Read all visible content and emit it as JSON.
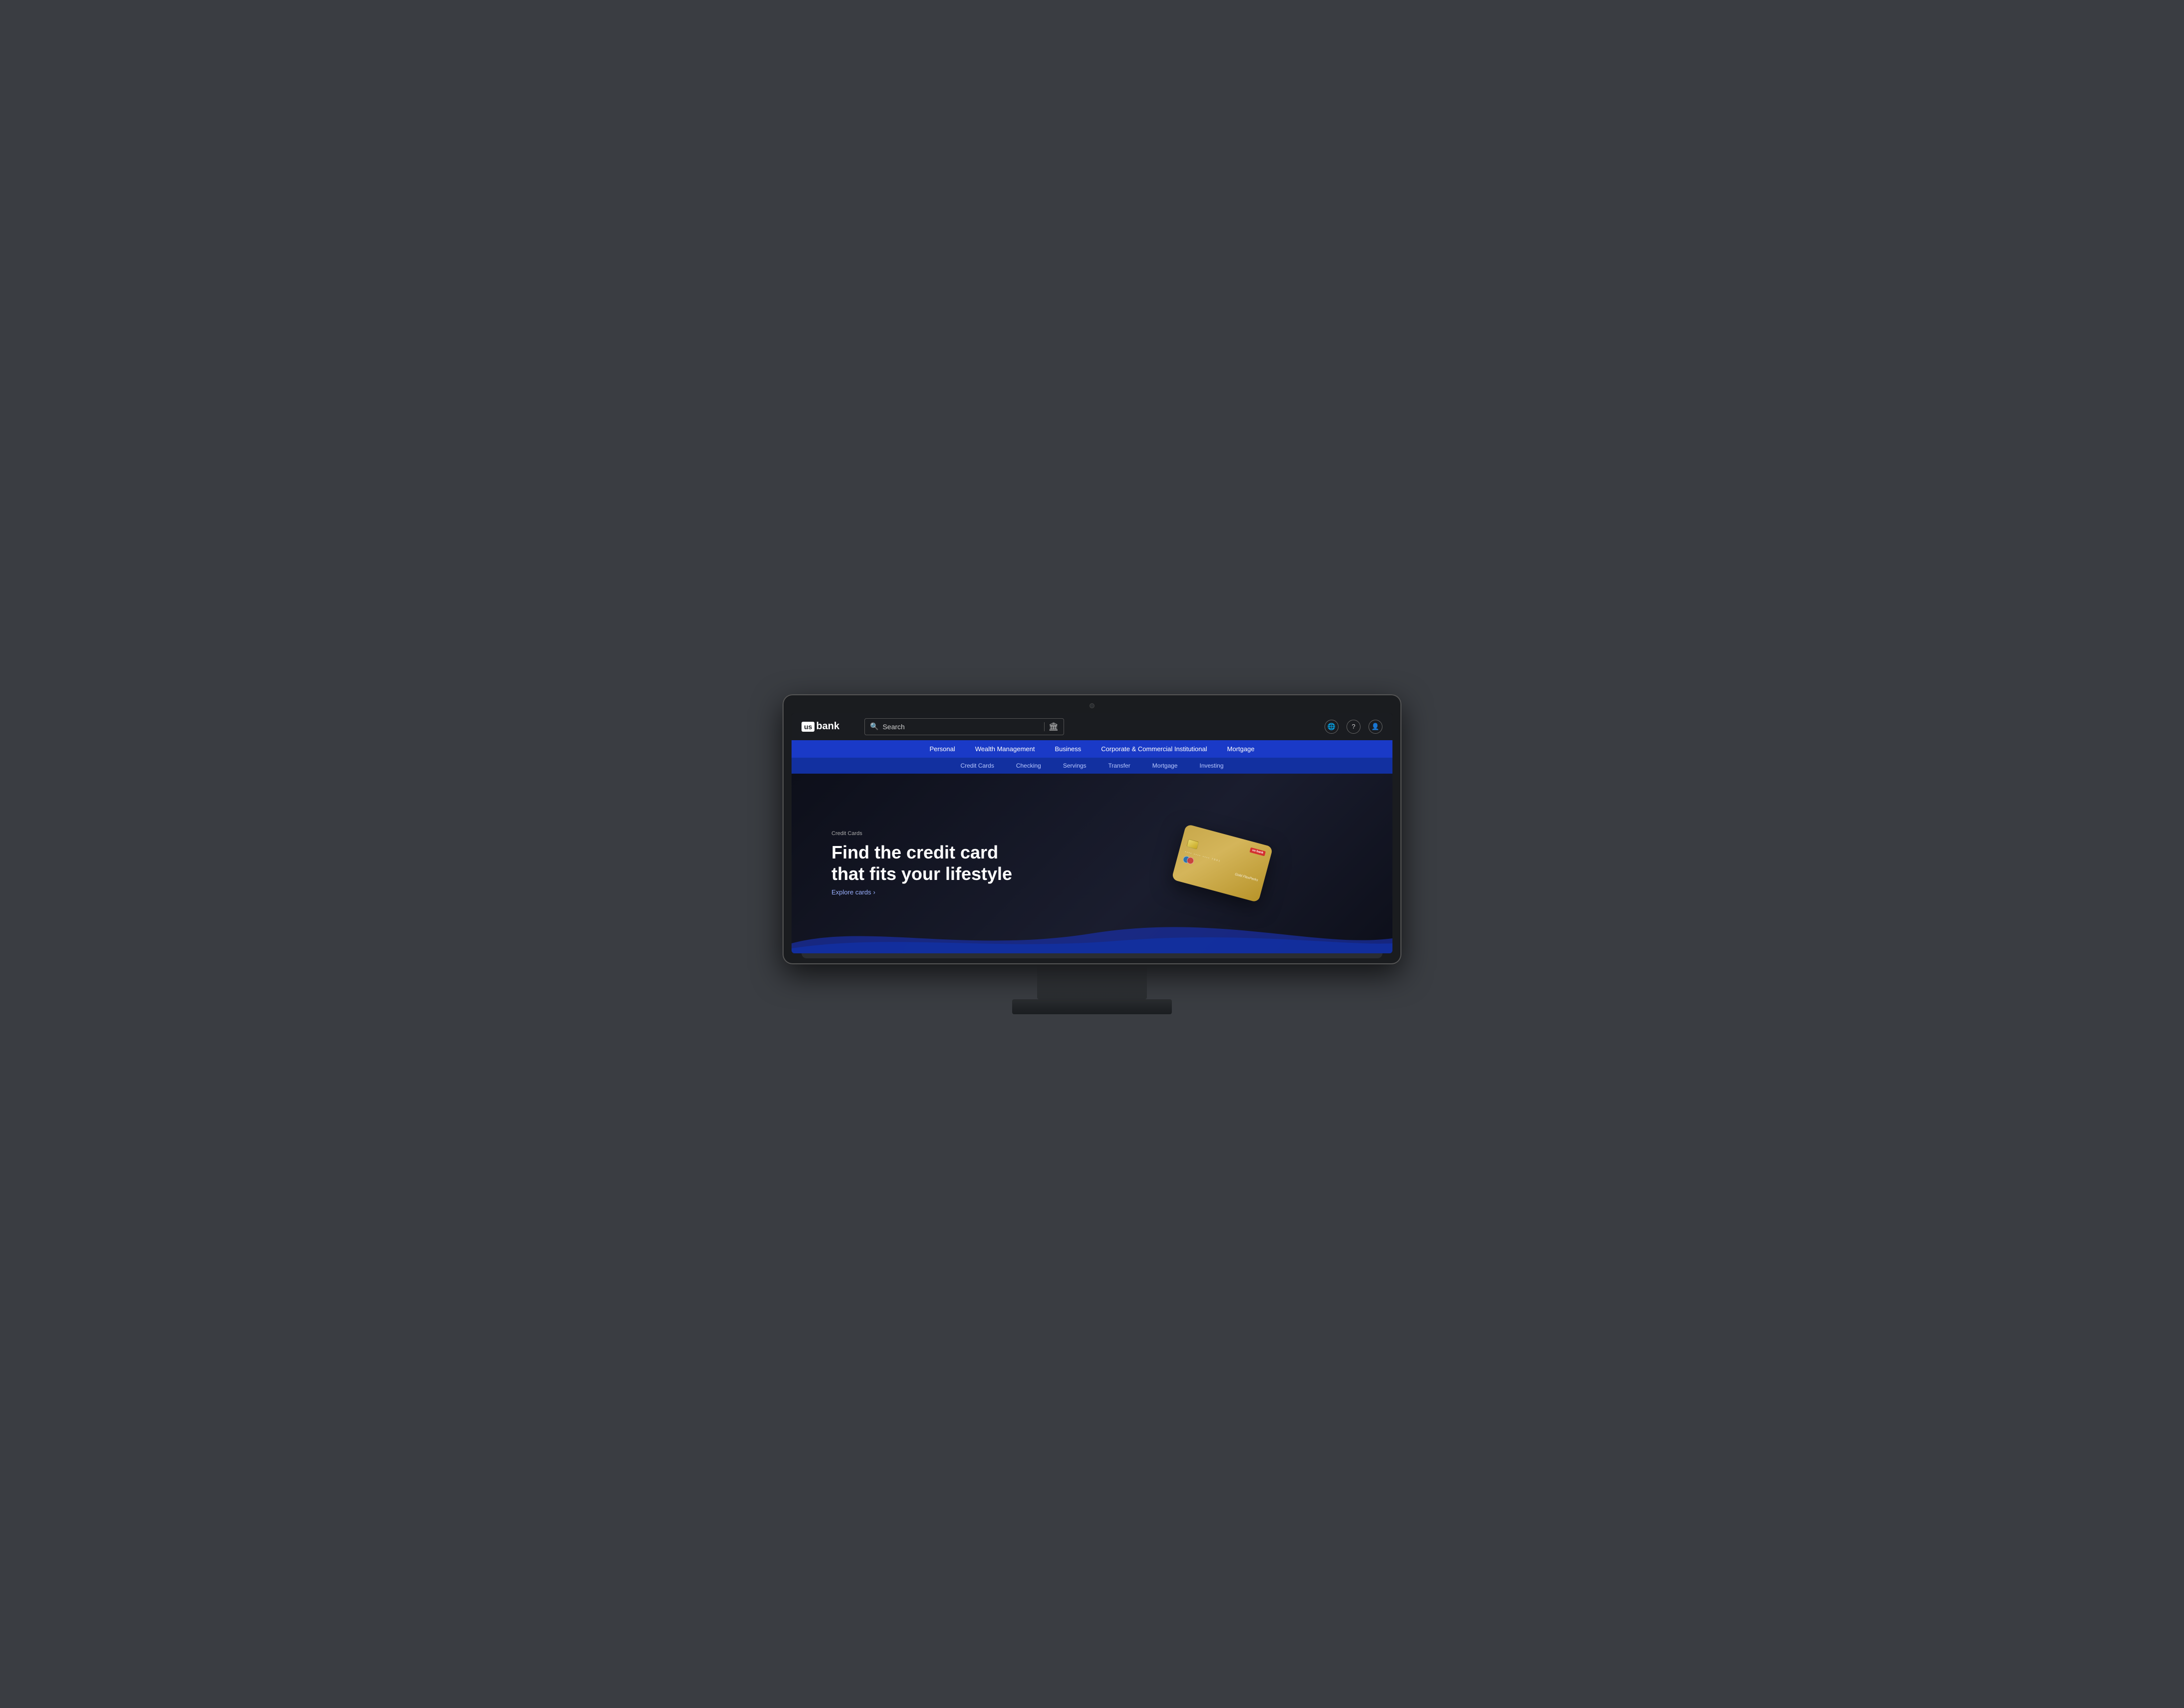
{
  "logo": {
    "us_text": "us",
    "bank_text": "bank"
  },
  "search": {
    "placeholder": "Search",
    "label": "Search"
  },
  "header_icons": {
    "globe_label": "Language",
    "help_label": "Help",
    "user_label": "Account"
  },
  "primary_nav": {
    "items": [
      {
        "id": "personal",
        "label": "Personal"
      },
      {
        "id": "wealth-management",
        "label": "Wealth Management"
      },
      {
        "id": "business",
        "label": "Business"
      },
      {
        "id": "corporate",
        "label": "Corporate & Commercial Institutional"
      },
      {
        "id": "mortgage",
        "label": "Mortgage"
      }
    ]
  },
  "secondary_nav": {
    "items": [
      {
        "id": "credit-cards",
        "label": "Credit Cards"
      },
      {
        "id": "checking",
        "label": "Checking"
      },
      {
        "id": "servings",
        "label": "Servings"
      },
      {
        "id": "transfer",
        "label": "Transfer"
      },
      {
        "id": "mortgage",
        "label": "Mortgage"
      },
      {
        "id": "investing",
        "label": "Investing"
      }
    ]
  },
  "hero": {
    "section_label": "Credit Cards",
    "title_line1": "Find the credit card",
    "title_line2": "that fits your lifestyle",
    "cta_text": "Explore cards",
    "cta_arrow": "›"
  },
  "card": {
    "brand": "usbank",
    "product_name": "FlexPerks",
    "card_type": "Gold",
    "number_hint": "7891",
    "network": "American Express"
  }
}
